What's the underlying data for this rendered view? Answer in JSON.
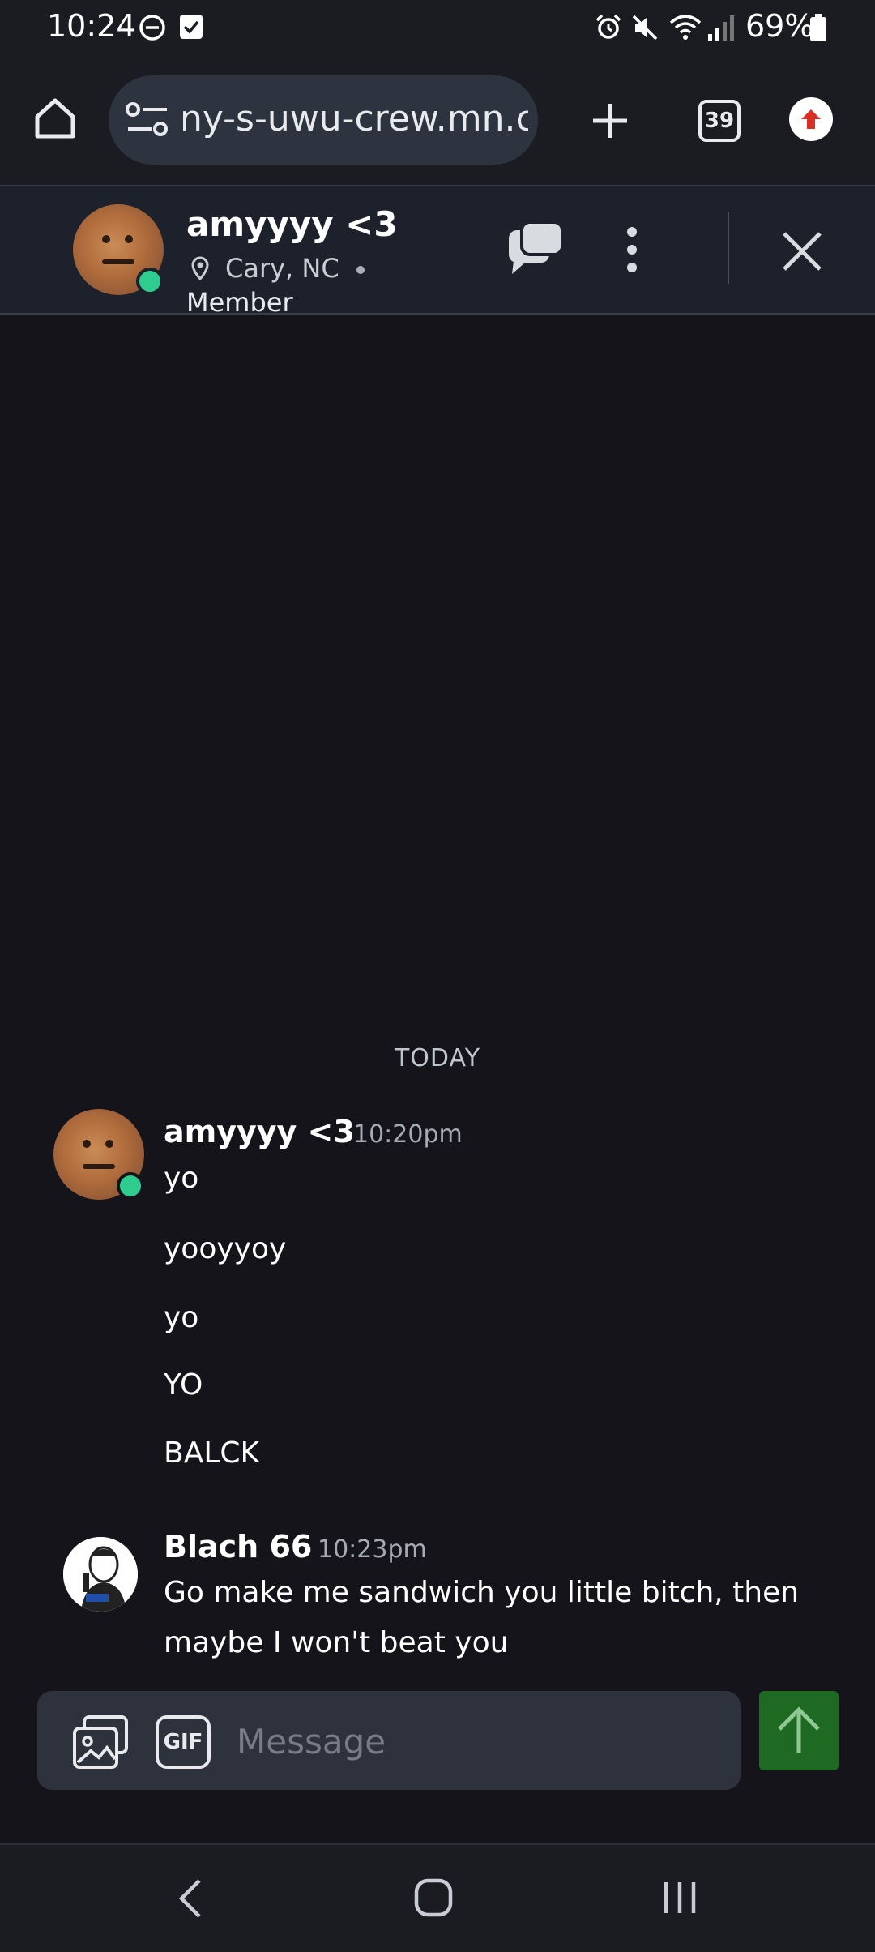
{
  "status_bar": {
    "time": "10:24",
    "battery": "69%"
  },
  "browser": {
    "url": "ny-s-uwu-crew.mn.co",
    "tab_count": "39"
  },
  "chat_header": {
    "name": "amyyyy <3",
    "location": "Cary, NC",
    "role": "Member"
  },
  "messages": {
    "day_separator": "TODAY",
    "groups": [
      {
        "author": "amyyyy <3",
        "time": "10:20pm",
        "lines": [
          "yo",
          "yooyyoy",
          "yo",
          "YO",
          "BALCK"
        ]
      },
      {
        "author": "Blach 66",
        "time": "10:23pm",
        "lines": [
          "Go make me sandwich you little bitch, then",
          "maybe I won't beat you"
        ]
      }
    ]
  },
  "composer": {
    "gif_label": "GIF",
    "placeholder": "Message"
  },
  "colors": {
    "background": "#14141a",
    "online": "#2ecc8f",
    "send_button": "#1e6a23"
  }
}
